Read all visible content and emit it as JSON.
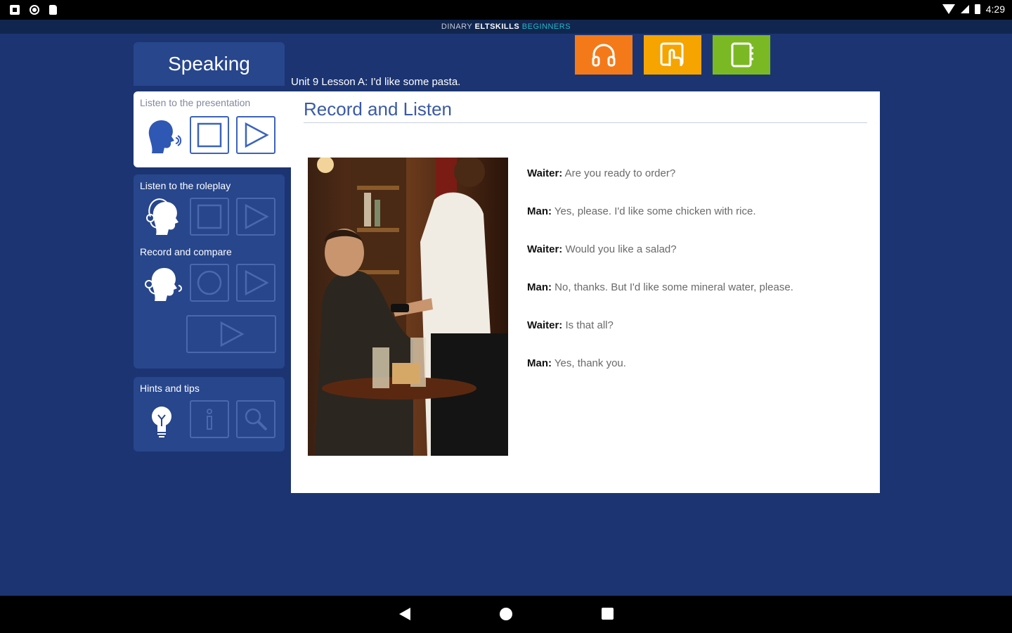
{
  "status_bar": {
    "time": "4:29"
  },
  "brand": {
    "part1": "DINARY ",
    "part2": "ELTSKILLS ",
    "part3": "BEGINNERS"
  },
  "header": {
    "tab_label": "Speaking",
    "lesson_title": "Unit 9 Lesson A: I'd like some pasta."
  },
  "top_buttons": [
    {
      "icon": "headphones-icon",
      "color": "#f47a19"
    },
    {
      "icon": "touch-icon",
      "color": "#f5a400"
    },
    {
      "icon": "notebook-icon",
      "color": "#7bb924"
    }
  ],
  "sidebar": {
    "presentation_title": "Listen to the presentation",
    "roleplay_title": "Listen to the roleplay",
    "record_title": "Record and compare",
    "hints_title": "Hints and tips"
  },
  "content": {
    "title": "Record and Listen",
    "dialog": [
      {
        "speaker": "Waiter:",
        "text": " Are you ready to order?"
      },
      {
        "speaker": "Man:",
        "text": " Yes, please. I'd like some chicken with rice."
      },
      {
        "speaker": "Waiter:",
        "text": " Would you like a salad?"
      },
      {
        "speaker": "Man:",
        "text": " No, thanks. But I'd like some mineral water, please."
      },
      {
        "speaker": "Waiter:",
        "text": " Is that all?"
      },
      {
        "speaker": "Man:",
        "text": " Yes, thank you."
      }
    ]
  }
}
